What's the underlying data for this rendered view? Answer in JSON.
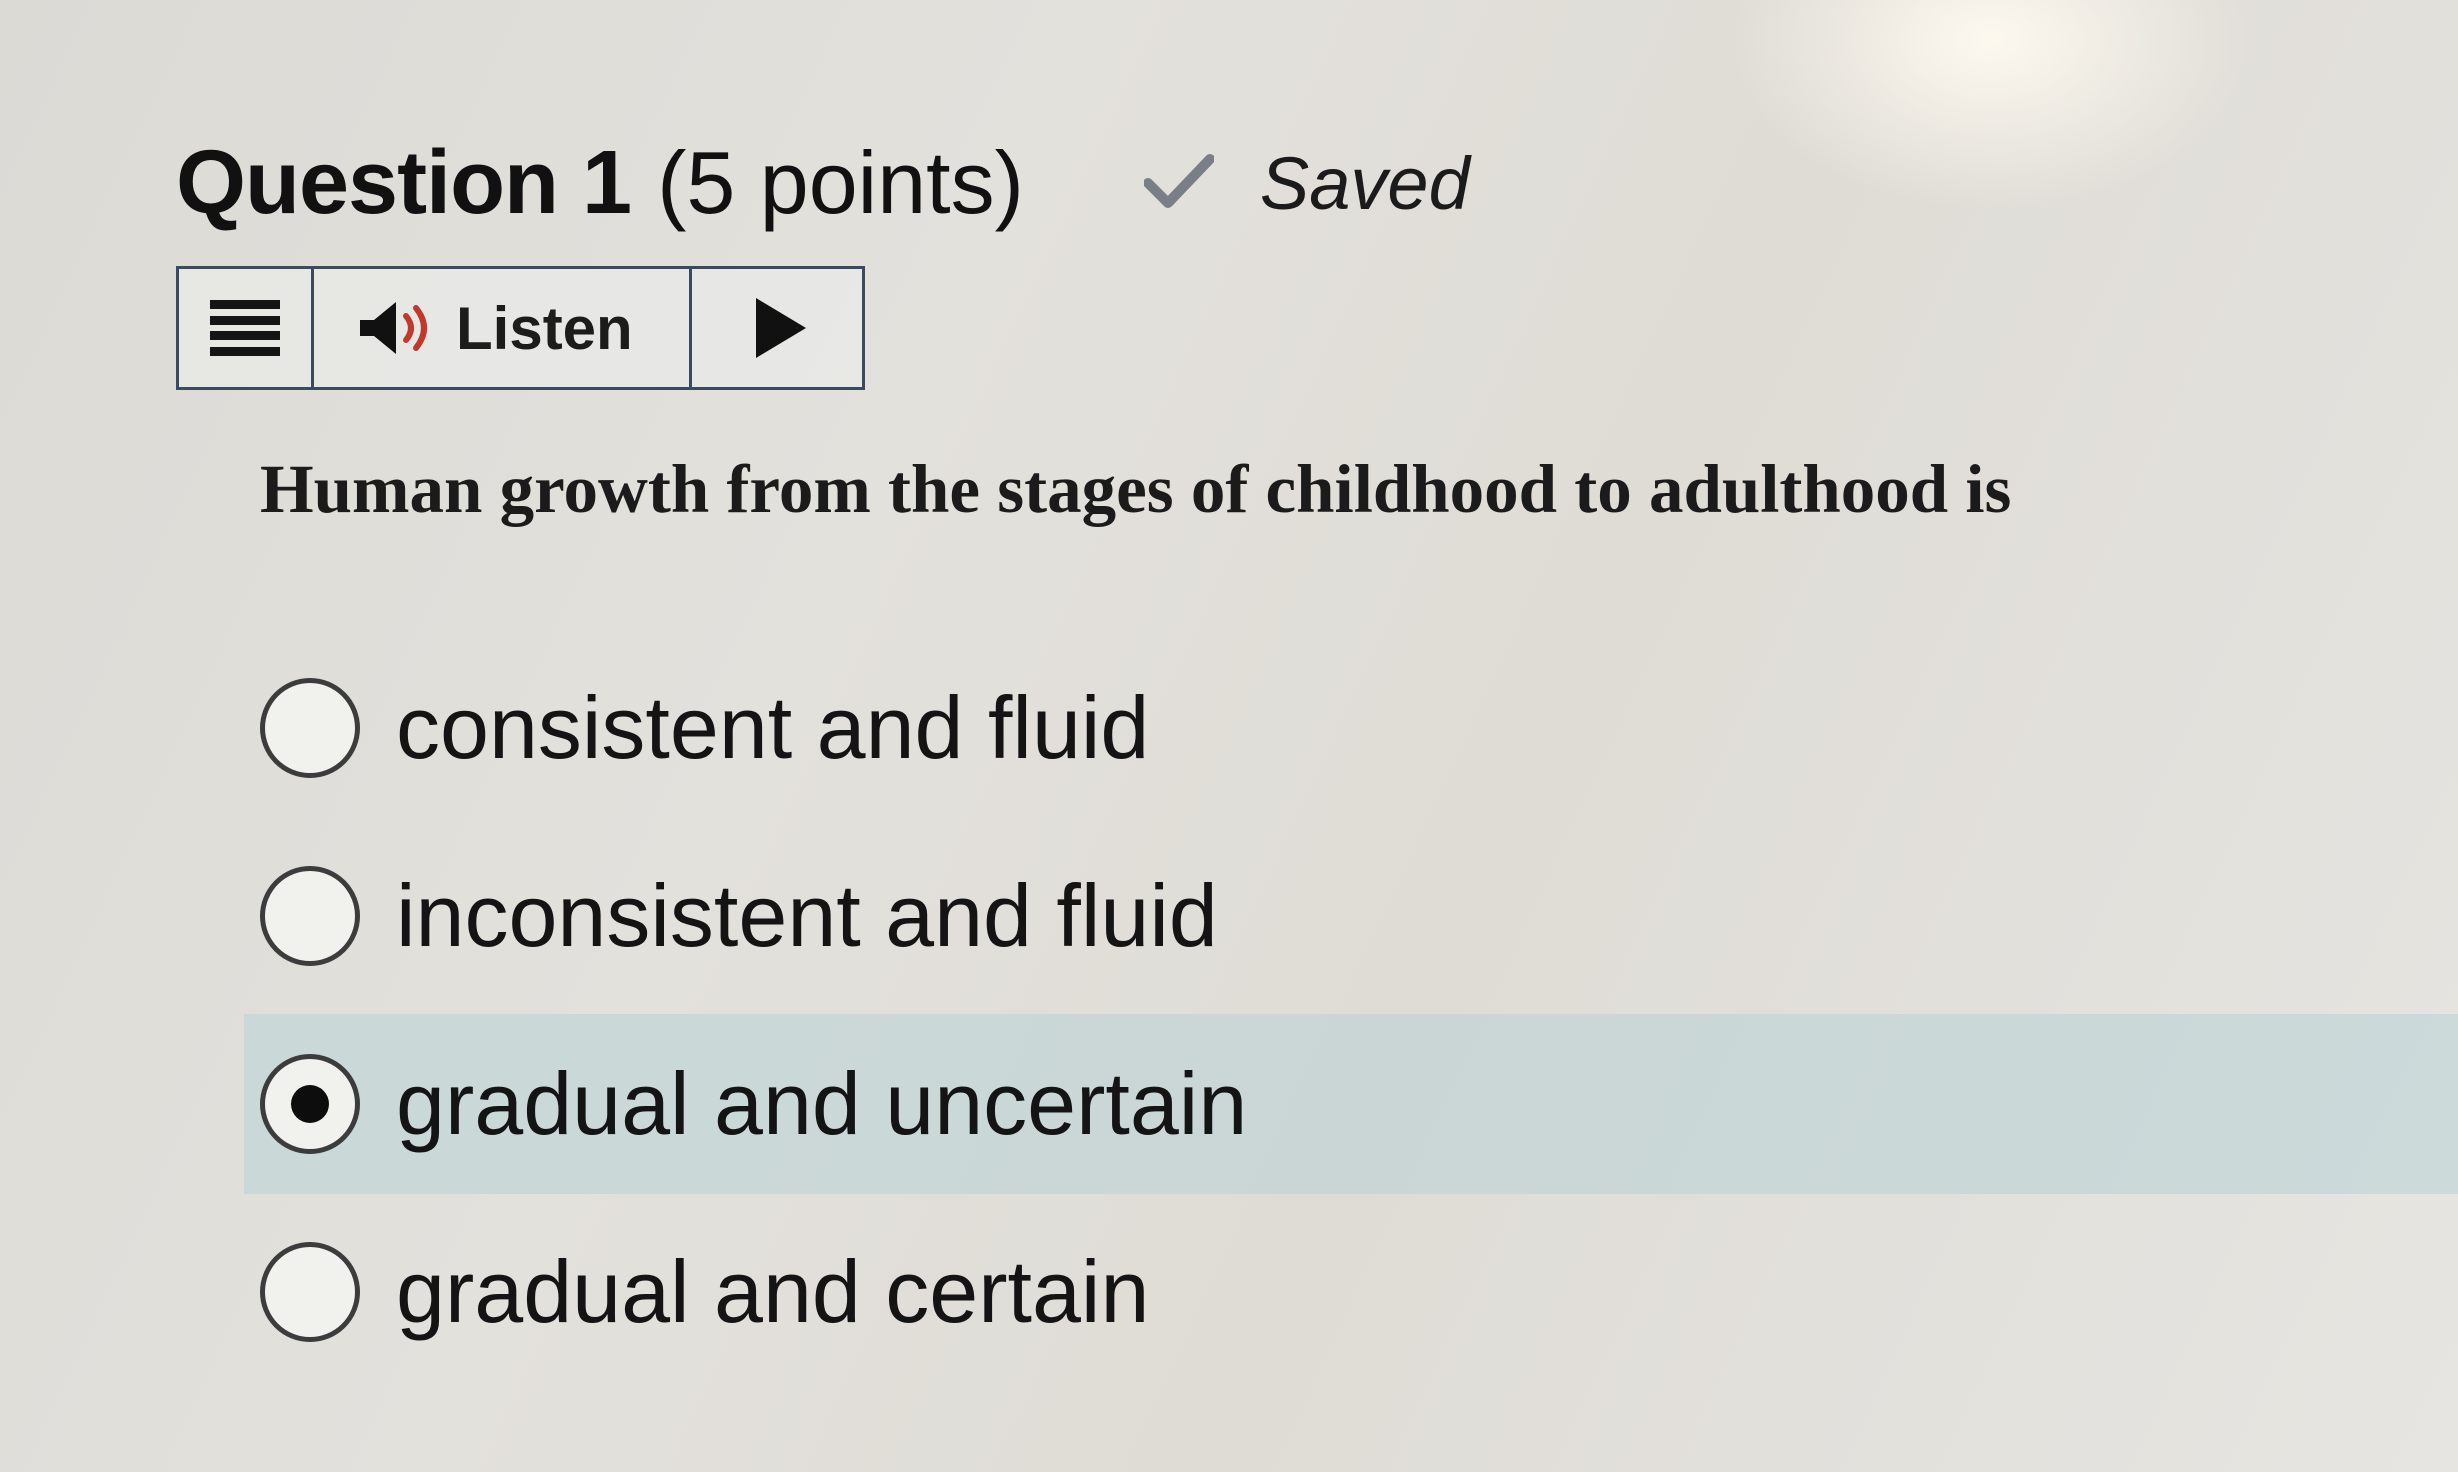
{
  "question": {
    "title": "Question 1",
    "points": "(5 points)",
    "status": "Saved",
    "text": "Human growth from the stages of childhood to adulthood is"
  },
  "toolbar": {
    "menu_icon": "hamburger-menu-icon",
    "speaker_icon": "speaker-icon",
    "listen_label": "Listen",
    "play_icon": "play-icon"
  },
  "options": [
    {
      "label": "consistent and fluid",
      "selected": false
    },
    {
      "label": "inconsistent and fluid",
      "selected": false
    },
    {
      "label": "gradual and uncertain",
      "selected": true
    },
    {
      "label": "gradual and certain",
      "selected": false
    }
  ],
  "colors": {
    "selected_highlight": "#b8d1d6",
    "toolbar_border": "#3a4a5f",
    "check_color": "#7a7f86"
  }
}
